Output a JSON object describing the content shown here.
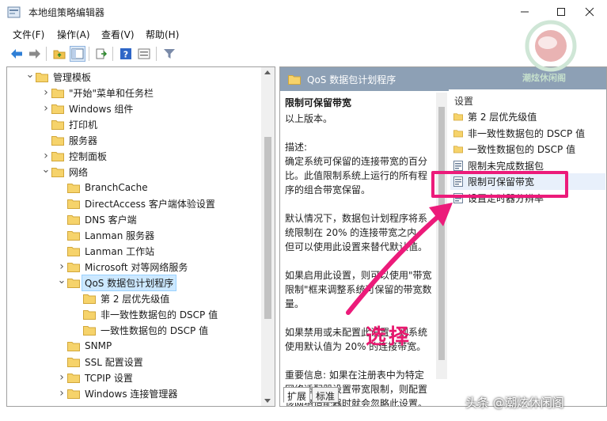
{
  "window": {
    "title": "本地组策略编辑器"
  },
  "menu": [
    "文件(F)",
    "操作(A)",
    "查看(V)",
    "帮助(H)"
  ],
  "tree": [
    {
      "label": "管理模板",
      "expander": "open"
    },
    {
      "label": "\"开始\"菜单和任务栏",
      "expander": "closed"
    },
    {
      "label": "Windows 组件",
      "expander": "closed"
    },
    {
      "label": "打印机",
      "expander": "none"
    },
    {
      "label": "服务器",
      "expander": "none"
    },
    {
      "label": "控制面板",
      "expander": "closed"
    },
    {
      "label": "网络",
      "expander": "open"
    },
    {
      "label": "BranchCache",
      "expander": "none"
    },
    {
      "label": "DirectAccess 客户端体验设置",
      "expander": "none"
    },
    {
      "label": "DNS 客户端",
      "expander": "none"
    },
    {
      "label": "Lanman 服务器",
      "expander": "none"
    },
    {
      "label": "Lanman 工作站",
      "expander": "none"
    },
    {
      "label": "Microsoft 对等网络服务",
      "expander": "closed"
    },
    {
      "label": "QoS 数据包计划程序",
      "expander": "open",
      "selected": true
    },
    {
      "label": "第 2 层优先级值",
      "expander": "none"
    },
    {
      "label": "非一致性数据包的 DSCP 值",
      "expander": "none"
    },
    {
      "label": "一致性数据包的 DSCP 值",
      "expander": "none"
    },
    {
      "label": "SNMP",
      "expander": "none"
    },
    {
      "label": "SSL 配置设置",
      "expander": "none"
    },
    {
      "label": "TCPIP 设置",
      "expander": "closed"
    },
    {
      "label": "Windows 连接管理器",
      "expander": "closed"
    }
  ],
  "right": {
    "header": "QoS 数据包计划程序",
    "description_title": "限制可保留带宽",
    "description": "以上版本。\n\n描述:\n确定系统可保留的连接带宽的百分比。此值限制系统上运行的所有程序的组合带宽保留。\n\n默认情况下，数据包计划程序将系统限制在 20% 的连接带宽之内，但可以使用此设置来替代默认值。\n\n如果启用此设置，则可以使用\"带宽限制\"框来调整系统可保留的带宽数量。\n\n如果禁用或未配置此设置，则系统使用默认值为 20% 的连接带宽。\n\n重要信息: 如果在注册表中为特定网络适配器设置带宽限制，则配置该网络适配器时就会忽略此设置。",
    "list_header": "设置",
    "settings": [
      {
        "label": "第 2 层优先级值",
        "type": "folder"
      },
      {
        "label": "非一致性数据包的 DSCP 值",
        "type": "folder"
      },
      {
        "label": "一致性数据包的 DSCP 值",
        "type": "folder"
      },
      {
        "label": "限制未完成数据包",
        "type": "setting"
      },
      {
        "label": "限制可保留带宽",
        "type": "setting",
        "selected": true
      },
      {
        "label": "设置定时器分辨率",
        "type": "setting"
      }
    ],
    "tabs": [
      "扩展",
      "标准"
    ]
  },
  "annotation": {
    "text": "选择",
    "color": "#ec1b7a"
  },
  "watermark": {
    "logo_text": "潮炫休闲阁",
    "bottom": "头条 @潮炫休闲阁"
  }
}
